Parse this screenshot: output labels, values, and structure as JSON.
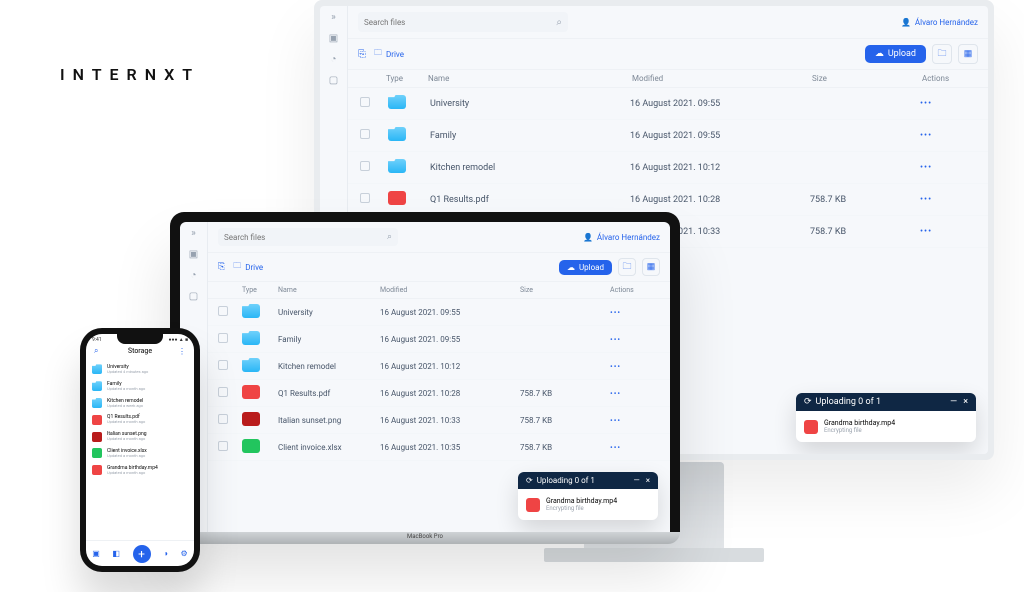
{
  "logo": "INTERNXT",
  "user": {
    "name": "Álvaro Hernández"
  },
  "search": {
    "placeholder": "Search files"
  },
  "breadcrumb": {
    "label": "Drive"
  },
  "buttons": {
    "upload": "Upload"
  },
  "columns": {
    "type": "Type",
    "name": "Name",
    "modified": "Modified",
    "size": "Size",
    "actions": "Actions"
  },
  "files": [
    {
      "icon": "folder-blue",
      "name": "University",
      "modified": "16 August 2021. 09:55",
      "size": ""
    },
    {
      "icon": "folder-blue",
      "name": "Family",
      "modified": "16 August 2021. 09:55",
      "size": ""
    },
    {
      "icon": "folder-blue",
      "name": "Kitchen remodel",
      "modified": "16 August 2021. 10:12",
      "size": ""
    },
    {
      "icon": "file-red",
      "name": "Q1 Results.pdf",
      "modified": "16 August 2021. 10:28",
      "size": "758.7 KB"
    },
    {
      "icon": "file-pic",
      "name": "Italian sunset.png",
      "modified": "16 August 2021. 10:33",
      "size": "758.7 KB"
    },
    {
      "icon": "file-green",
      "name": "Client invoice.xlsx",
      "modified": "16 August 2021. 10:35",
      "size": "758.7 KB"
    }
  ],
  "upload_toast": {
    "title": "Uploading 0 of 1",
    "file": "Grandma birthday.mp4",
    "status": "Encrypting file"
  },
  "phone": {
    "time": "9:41",
    "title": "Storage",
    "items": [
      {
        "icon": "folder-blue",
        "name": "University",
        "sub": "Updated 4 minutes ago"
      },
      {
        "icon": "folder-blue",
        "name": "Family",
        "sub": "Updated a month ago"
      },
      {
        "icon": "folder-blue",
        "name": "Kitchen remodel",
        "sub": "Updated a week ago"
      },
      {
        "icon": "file-red",
        "name": "Q1 Results.pdf",
        "sub": "Updated a month ago"
      },
      {
        "icon": "file-pic",
        "name": "Italian sunset.png",
        "sub": "Updated a month ago"
      },
      {
        "icon": "file-green",
        "name": "Client invoice.xlsx",
        "sub": "Updated a month ago"
      },
      {
        "icon": "file-red",
        "name": "Grandma birthday.mp4",
        "sub": "Updated a month ago"
      }
    ]
  },
  "laptop_label": "MacBook Pro"
}
